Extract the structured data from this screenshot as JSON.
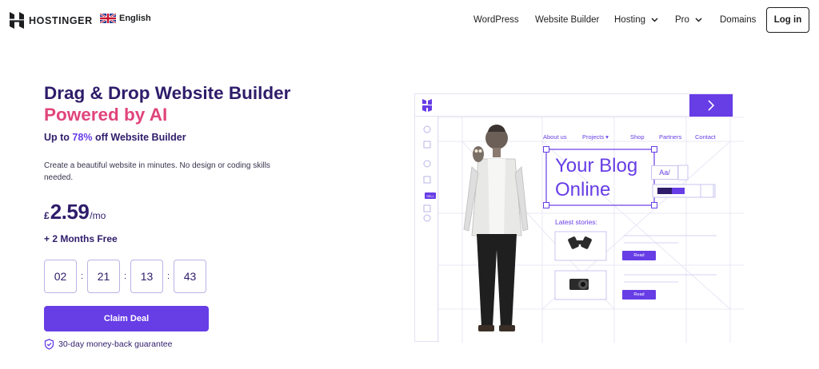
{
  "header": {
    "brand": "HOSTINGER",
    "language": "English",
    "nav": [
      {
        "label": "WordPress",
        "dropdown": false
      },
      {
        "label": "Website Builder",
        "dropdown": false
      },
      {
        "label": "Hosting",
        "dropdown": true
      },
      {
        "label": "Pro",
        "dropdown": true
      },
      {
        "label": "Domains",
        "dropdown": false
      }
    ],
    "login": "Log in"
  },
  "hero": {
    "title_main": "Drag & Drop Website Builder",
    "title_highlight": "Powered by AI",
    "subtitle_prefix": "Up to",
    "subtitle_percent": "78%",
    "subtitle_suffix": "off Website Builder",
    "description": "Create a beautiful website in minutes. No design or coding skills needed.",
    "currency": "£",
    "price": "2.59",
    "period": "/mo",
    "bonus": "+ 2 Months Free",
    "countdown": [
      "02",
      "21",
      "13",
      "43"
    ],
    "cta": "Claim Deal",
    "guarantee": "30-day money-back guarantee"
  },
  "illustration": {
    "menu": [
      "About us",
      "Projects ▾",
      "Shop",
      "Partners",
      "Contact"
    ],
    "blog_title_line1": "Your Blog",
    "blog_title_line2": "Online",
    "latest": "Latest stories:",
    "read_label": "Read",
    "font_tool": "Aa/",
    "sell_badge": "SELL"
  },
  "colors": {
    "brand_purple": "#673de6",
    "heading": "#2f1c6a",
    "accent_pink": "#e0457b"
  }
}
